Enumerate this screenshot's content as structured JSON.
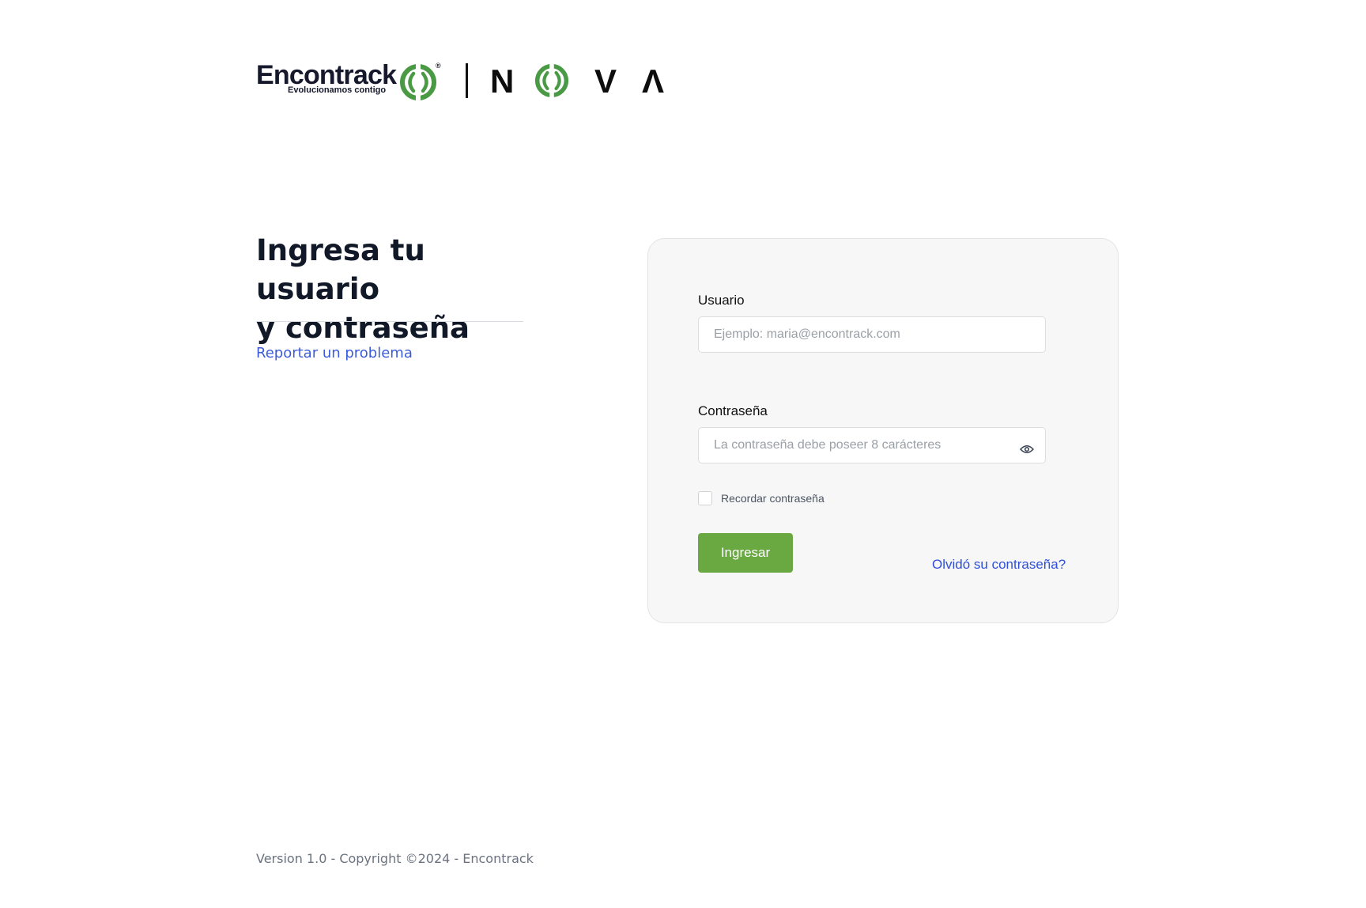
{
  "brand": {
    "name": "Encontrack",
    "tagline": "Evolucionamos contigo",
    "registered_mark": "®",
    "product_letters": [
      "N",
      "V",
      "Λ"
    ],
    "green": "#4a9a45",
    "dark": "#16192b"
  },
  "intro": {
    "title_line_1": "Ingresa tu usuario",
    "title_line_2": "y contraseña",
    "report_link": "Reportar un problema"
  },
  "login_form": {
    "username_label": "Usuario",
    "username_placeholder": "Ejemplo: maria@encontrack.com",
    "username_value": "",
    "password_label": "Contraseña",
    "password_placeholder": "La contraseña debe poseer 8 carácteres",
    "password_value": "",
    "password_toggle_icon": "eye-icon",
    "remember_label": "Recordar contraseña",
    "remember_checked": false,
    "submit_label": "Ingresar",
    "forgot_link": "Olvidó su contraseña?",
    "accent": "#6aa842",
    "link_color": "#2f4fd8"
  },
  "footer": {
    "text": "Version 1.0 - Copyright ©2024 - Encontrack"
  }
}
